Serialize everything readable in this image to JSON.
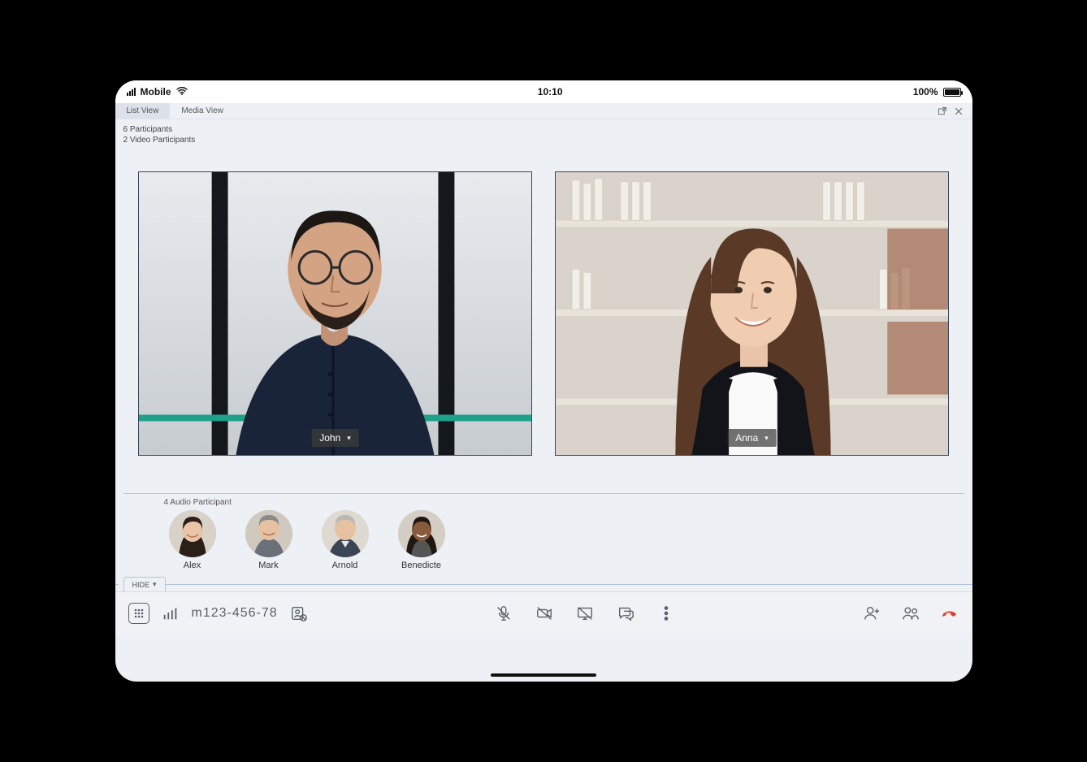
{
  "statusbar": {
    "carrier": "Mobile",
    "time": "10:10",
    "battery": "100%"
  },
  "tabs": {
    "list_view": "List View",
    "media_view": "Media View"
  },
  "header": {
    "participants": "6 Participants",
    "video_participants": "2 Video Participants"
  },
  "video_tiles": [
    {
      "name": "John"
    },
    {
      "name": "Anna"
    }
  ],
  "audio": {
    "label": "4 Audio Participant",
    "participants": [
      {
        "name": "Alex"
      },
      {
        "name": "Mark"
      },
      {
        "name": "Arnold"
      },
      {
        "name": "Benedicte"
      }
    ]
  },
  "hide_label": "HIDE",
  "toolbar": {
    "dial": "m123-456-78"
  }
}
